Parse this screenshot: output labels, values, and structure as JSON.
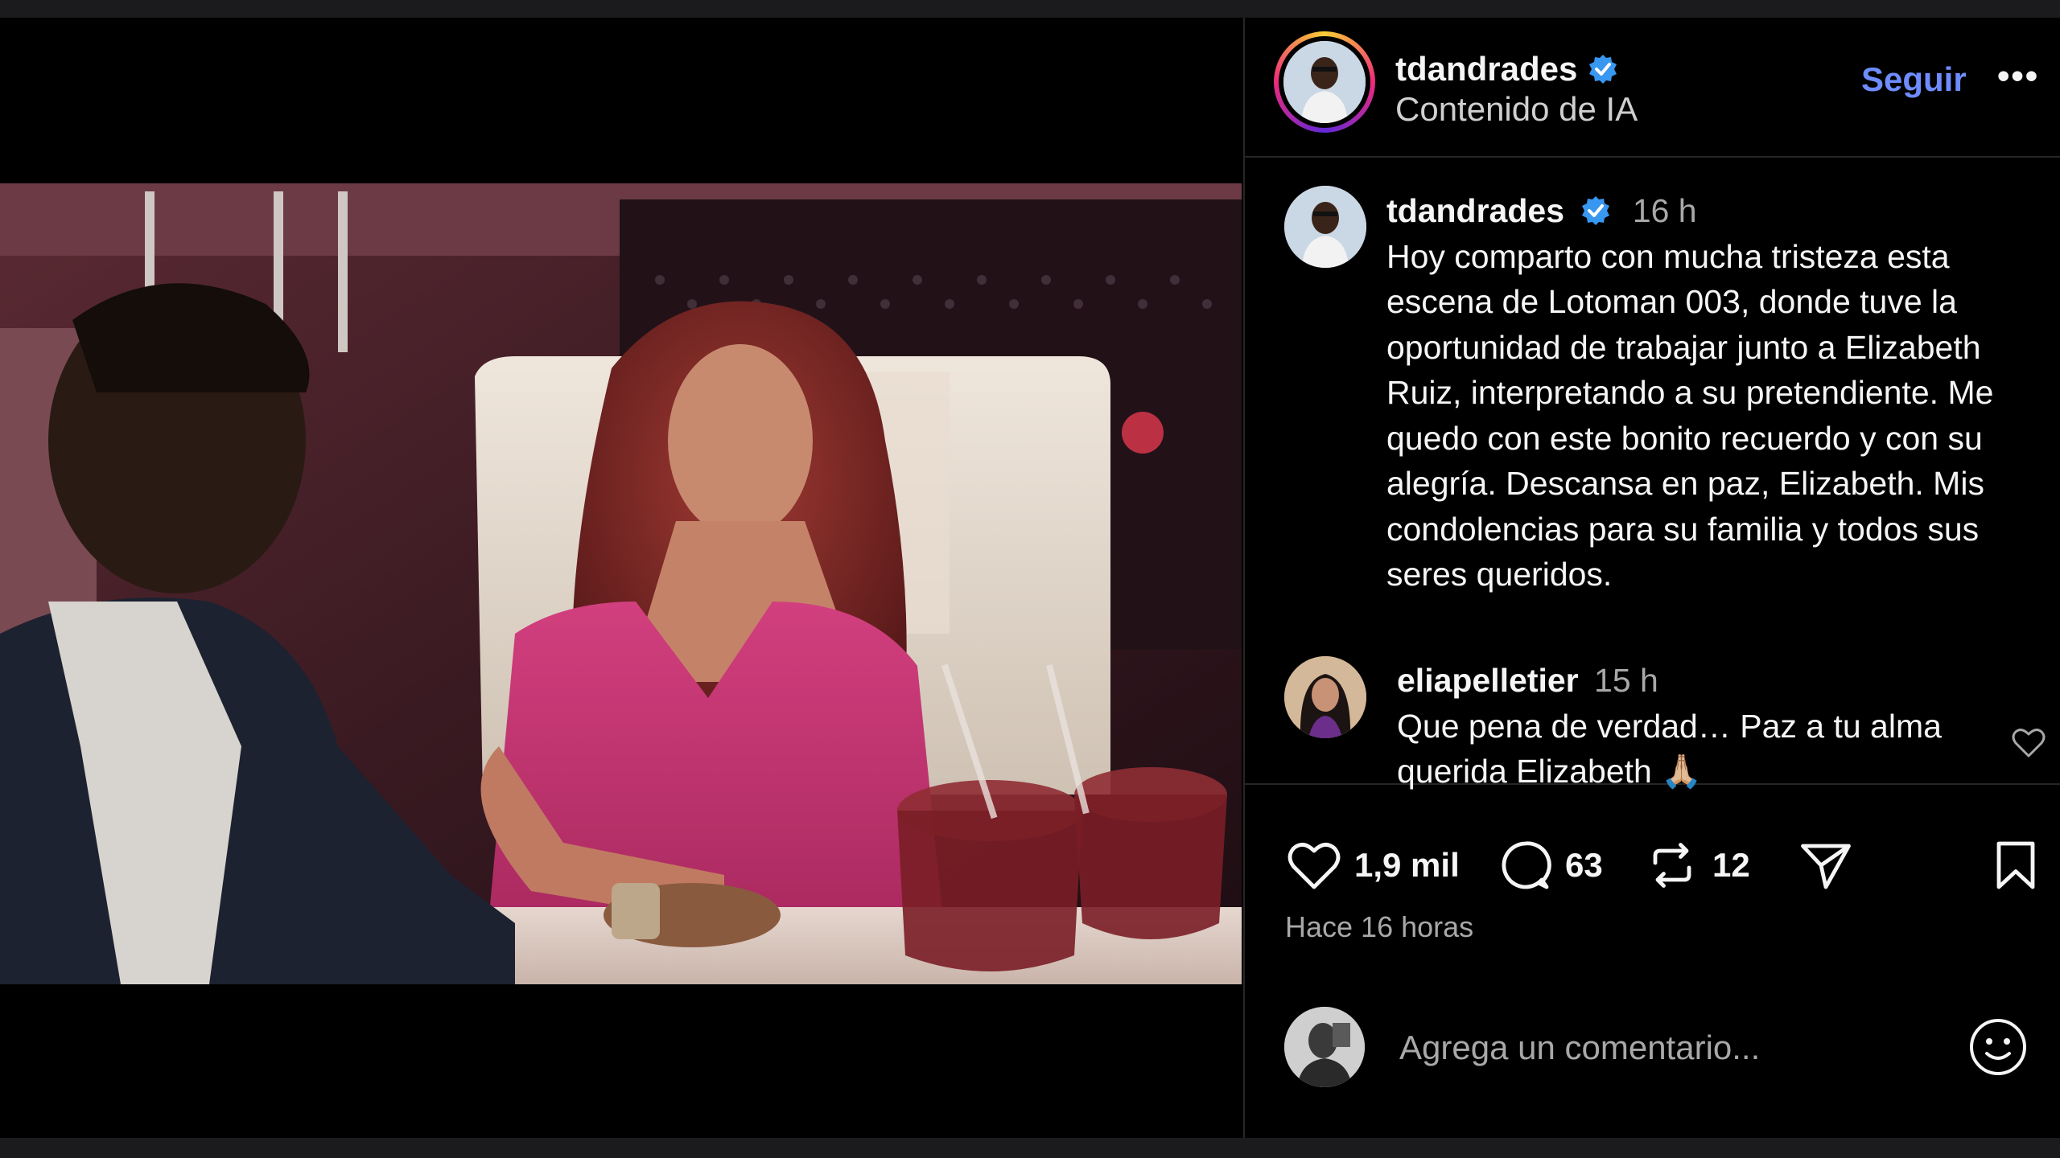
{
  "header": {
    "username": "tdandrades",
    "subtitle": "Contenido de IA",
    "follow_label": "Seguir",
    "more_label": "•••"
  },
  "caption": {
    "username": "tdandrades",
    "time": "16 h",
    "text": "Hoy comparto con mucha tristeza esta escena de Lotoman 003, donde tuve la oportunidad de trabajar junto a Elizabeth Ruiz, interpretando a su pretendiente. Me quedo con este bonito recuerdo y con su alegría. Descansa en paz, Elizabeth. Mis condolencias para su familia y todos sus seres queridos."
  },
  "comment": {
    "username": "eliapelletier",
    "time": "15 h",
    "text": "Que pena de verdad… Paz a tu alma querida Elizabeth 🙏🏼"
  },
  "actions": {
    "likes": "1,9 mil",
    "comments": "63",
    "reposts": "12"
  },
  "time_ago": "Hace 16 horas",
  "add_comment": {
    "placeholder": "Agrega un comentario..."
  },
  "icons": {
    "verified": "verified-badge-icon",
    "like": "heart-icon",
    "comment": "comment-bubble-icon",
    "repost": "repost-icon",
    "share": "send-icon",
    "save": "bookmark-icon",
    "emoji": "emoji-icon"
  },
  "colors": {
    "link": "#6f8cff",
    "verified": "#3897f0",
    "muted": "#a8a8a8"
  }
}
